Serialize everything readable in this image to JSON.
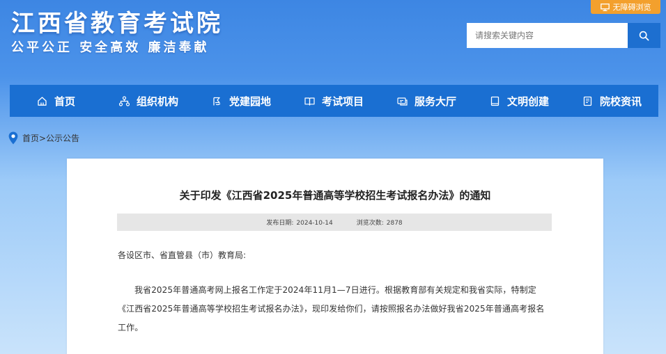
{
  "header": {
    "site_title": "江西省教育考试院",
    "slogan": "公平公正  安全高效  廉洁奉献",
    "accessibility_label": "无障碍浏览",
    "search_placeholder": "请搜索关键内容"
  },
  "nav": {
    "items": [
      {
        "label": "首页",
        "icon": "home-icon"
      },
      {
        "label": "组织机构",
        "icon": "org-chart-icon"
      },
      {
        "label": "党建园地",
        "icon": "party-icon"
      },
      {
        "label": "考试项目",
        "icon": "book-open-icon"
      },
      {
        "label": "服务大厅",
        "icon": "service-hall-icon"
      },
      {
        "label": "文明创建",
        "icon": "book-icon"
      },
      {
        "label": "院校资讯",
        "icon": "document-icon"
      }
    ]
  },
  "breadcrumb": {
    "text": "首页>公示公告"
  },
  "article": {
    "title": "关于印发《江西省2025年普通高等学校招生考试报名办法》的通知",
    "publish_label": "发布日期:",
    "publish_date": "2024-10-14",
    "views_label": "浏览次数:",
    "views": "2878",
    "salutation": "各设区市、省直管县（市）教育局:",
    "paragraph": "我省2025年普通高考网上报名工作定于2024年11月1—7日进行。根据教育部有关规定和我省实际，特制定《江西省2025年普通高等学校招生考试报名办法》，现印发给你们，请按照报名办法做好我省2025年普通高考报名工作。"
  },
  "colors": {
    "nav_bg": "#1a6fd2",
    "accessibility_bg": "#f3a02d",
    "search_button_bg": "#1d6fd0",
    "page_gradient_top": "#3d86e3",
    "page_gradient_bottom": "#c9e3fb"
  }
}
